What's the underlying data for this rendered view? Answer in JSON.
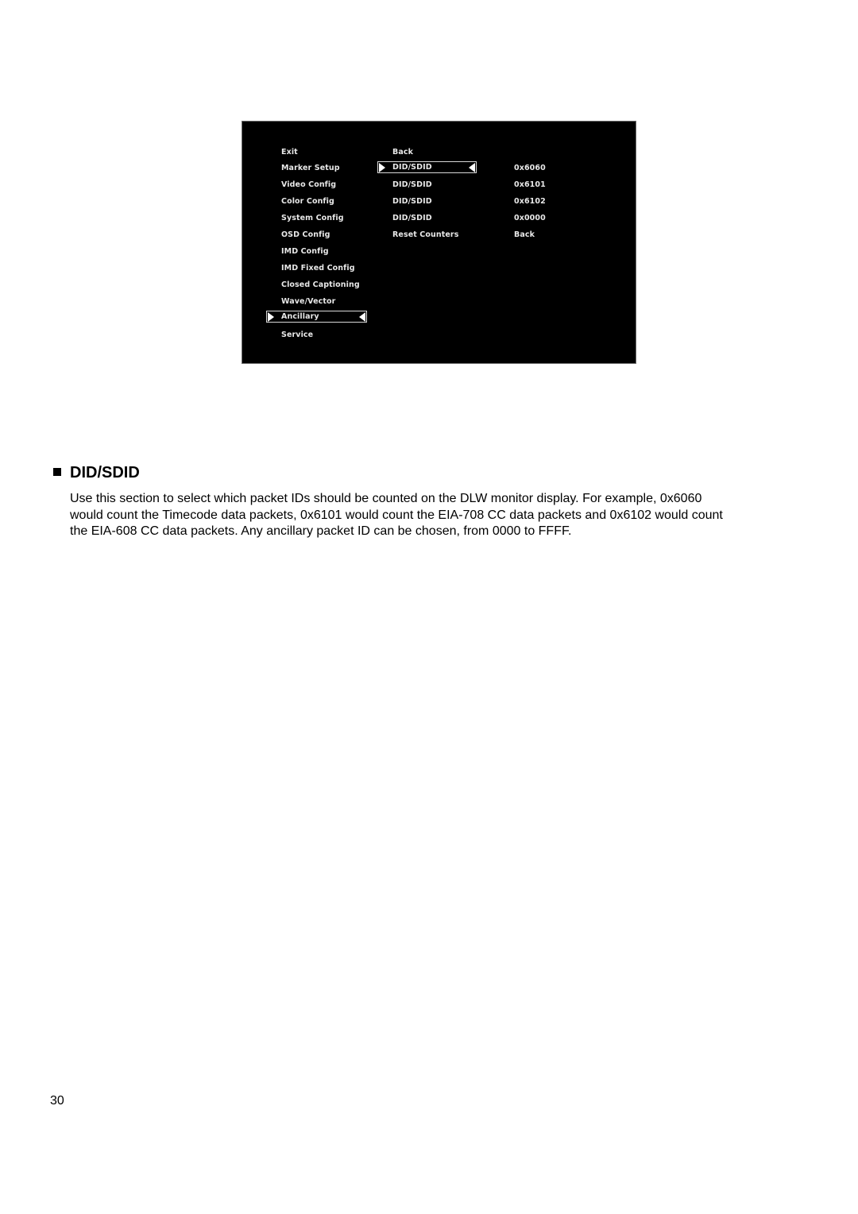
{
  "osd_menu": {
    "main_menu": [
      {
        "label": "Exit",
        "selected": false
      },
      {
        "label": "Marker Setup",
        "selected": false
      },
      {
        "label": "Video Config",
        "selected": false
      },
      {
        "label": "Color Config",
        "selected": false
      },
      {
        "label": "System Config",
        "selected": false
      },
      {
        "label": "OSD Config",
        "selected": false
      },
      {
        "label": "IMD Config",
        "selected": false
      },
      {
        "label": "IMD Fixed Config",
        "selected": false
      },
      {
        "label": "Closed Captioning",
        "selected": false
      },
      {
        "label": "Wave/Vector",
        "selected": false
      },
      {
        "label": "Ancillary",
        "selected": true
      },
      {
        "label": "Service",
        "selected": false
      }
    ],
    "submenu": [
      {
        "label": "Back",
        "selected": false
      },
      {
        "label": "DID/SDID",
        "selected": true
      },
      {
        "label": "DID/SDID",
        "selected": false
      },
      {
        "label": "DID/SDID",
        "selected": false
      },
      {
        "label": "DID/SDID",
        "selected": false
      },
      {
        "label": "Reset Counters",
        "selected": false
      }
    ],
    "values": [
      {
        "label": "0x6060"
      },
      {
        "label": "0x6101"
      },
      {
        "label": "0x6102"
      },
      {
        "label": "0x0000"
      },
      {
        "label": "Back"
      }
    ]
  },
  "section": {
    "title": "DID/SDID",
    "body_lines": [
      "Use this section to select which packet IDs should be counted on the DLW monitor display.  For example, 0x6060",
      "would count the Timecode data packets, 0x6101 would count the EIA-708 CC data packets and 0x6102 would count",
      "the EIA-608 CC data packets.  Any ancillary packet ID can be chosen, from 0000 to FFFF."
    ]
  },
  "page_number": "30"
}
